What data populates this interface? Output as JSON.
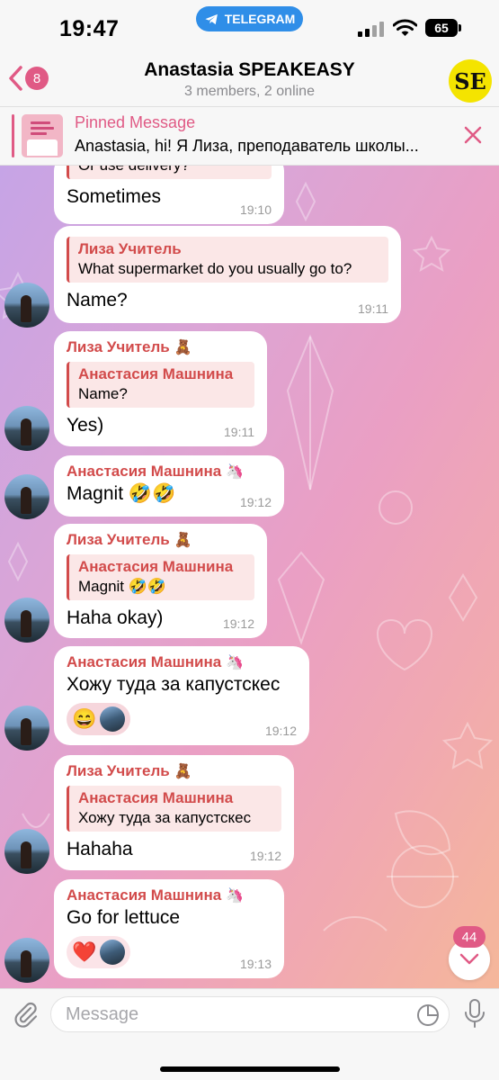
{
  "status_bar": {
    "time": "19:47",
    "app_pill": "TELEGRAM",
    "battery": "65"
  },
  "header": {
    "back_count": "8",
    "title": "Anastasia SPEAKEASY",
    "subtitle": "3 members, 2 online",
    "avatar_text": "SE"
  },
  "pinned": {
    "title": "Pinned Message",
    "text": "Anastasia, hi! Я Лиза, преподаватель школы..."
  },
  "messages": [
    {
      "quote_text": "Or use delivery?",
      "text": "Sometimes",
      "time": "19:10"
    },
    {
      "quote_name": "Лиза Учитель",
      "quote_text": "What supermarket do you usually go to?",
      "text": "Name?",
      "time": "19:11"
    },
    {
      "sender": "Лиза Учитель",
      "sender_emoji": "🧸",
      "quote_name": "Анастасия Машнина",
      "quote_text": "Name?",
      "text": "Yes)",
      "time": "19:11"
    },
    {
      "sender": "Анастасия Машнина",
      "sender_emoji": "🦄",
      "text": "Magnit 🤣🤣",
      "time": "19:12"
    },
    {
      "sender": "Лиза Учитель",
      "sender_emoji": "🧸",
      "quote_name": "Анастасия Машнина",
      "quote_text": "Magnit 🤣🤣",
      "text": "Haha okay)",
      "time": "19:12"
    },
    {
      "sender": "Анастасия Машнина",
      "sender_emoji": "🦄",
      "text": "Хожу туда за капустскес",
      "reaction": "😄",
      "time": "19:12"
    },
    {
      "sender": "Лиза Учитель",
      "sender_emoji": "🧸",
      "quote_name": "Анастасия Машнина",
      "quote_text": "Хожу туда за капустскес",
      "text": "Hahaha",
      "time": "19:12"
    },
    {
      "sender": "Анастасия Машнина",
      "sender_emoji": "🦄",
      "text": "Go for lettuce",
      "reaction": "❤️",
      "time": "19:13"
    }
  ],
  "scroll_badge": "44",
  "input": {
    "placeholder": "Message"
  },
  "colors": {
    "accent": "#e05a85",
    "sender": "#d24b4b",
    "pill": "#2f8ee8"
  }
}
